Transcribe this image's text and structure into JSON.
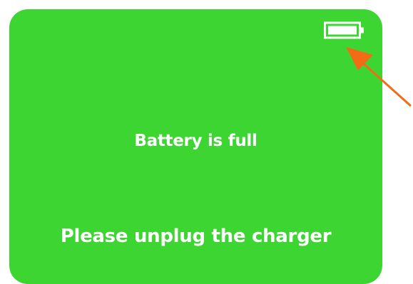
{
  "screen": {
    "background_color": "#3dd532",
    "text_color": "#ffffff"
  },
  "status_bar": {
    "battery_icon": "battery-full-icon",
    "battery_level_percent": 100
  },
  "messages": {
    "primary": "Battery is full",
    "secondary": "Please unplug the charger"
  },
  "annotation": {
    "icon": "arrow-pointer-icon",
    "color": "#f26c17"
  }
}
